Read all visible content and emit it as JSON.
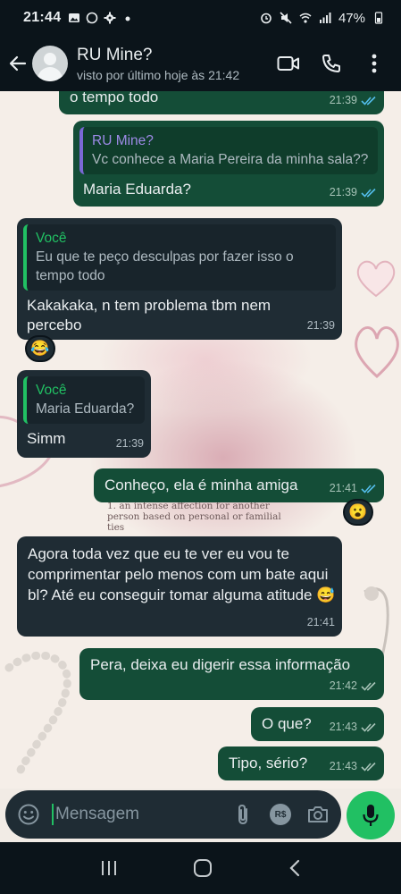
{
  "statusbar": {
    "time": "21:44",
    "battery": "47%",
    "left_icons": [
      "image-icon",
      "whatsapp-icon",
      "settings-icon",
      "dot-icon"
    ],
    "right_icons": [
      "alarm-icon",
      "mute-icon",
      "wifi-icon",
      "signal-icon",
      "battery-icon"
    ]
  },
  "header": {
    "contact_name": "RU Mine?",
    "last_seen": "visto por último hoje às 21:42"
  },
  "messages": [
    {
      "side": "out",
      "text": "o tempo todo",
      "time": "21:39"
    },
    {
      "side": "out",
      "quote_name": "RU Mine?",
      "quote_text": "Vc conhece a Maria Pereira da minha sala??",
      "text": "Maria Eduarda?",
      "time": "21:39"
    },
    {
      "side": "in",
      "quote_name": "Você",
      "quote_text": "Eu que te peço desculpas por fazer isso o tempo todo",
      "text": "Kakakaka, n tem problema tbm nem percebo",
      "time": "21:39",
      "reaction": "😂"
    },
    {
      "side": "in",
      "quote_name": "Você",
      "quote_text": "Maria Eduarda?",
      "text": "Simm",
      "time": "21:39"
    },
    {
      "side": "out",
      "text": "Conheço, ela é minha amiga",
      "time": "21:41",
      "reaction": "😮"
    },
    {
      "side": "in",
      "text": "Agora toda vez que eu te ver eu vou te comprimentar pelo menos com um bate aqui bl? Até eu conseguir tomar alguma atitude 😅",
      "time": "21:41"
    },
    {
      "side": "out",
      "text": "Pera, deixa eu digerir essa informação",
      "time": "21:42"
    },
    {
      "side": "out",
      "text": "O que?",
      "time": "21:43"
    },
    {
      "side": "out",
      "text": "Tipo, sério?",
      "time": "21:43"
    }
  ],
  "wallpaper": {
    "text_line1": "1. an intense affection for another",
    "text_line2": "person based on personal or familial",
    "text_line3": "ties"
  },
  "composer": {
    "placeholder": "Mensagem",
    "currency_label": "R$"
  },
  "colors": {
    "accent": "#21c063",
    "outgoing_bubble": "#144d37",
    "incoming_bubble": "#1f2c34",
    "read_tick": "#53bdeb",
    "quote_bar_out": "#7a68d6"
  }
}
